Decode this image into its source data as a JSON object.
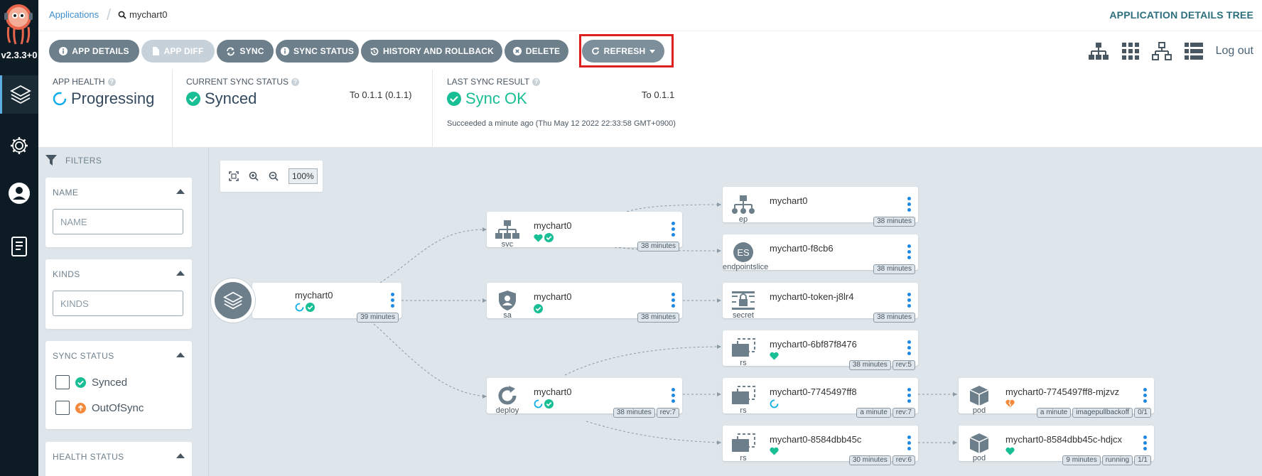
{
  "nav": {
    "version": "v2.3.3+0",
    "items": [
      {
        "icon": "layers-icon"
      },
      {
        "icon": "gear-icon"
      },
      {
        "icon": "user-icon"
      },
      {
        "icon": "docs-icon"
      }
    ]
  },
  "breadcrumb": {
    "root": "Applications",
    "current": "mychart0"
  },
  "page_title": "APPLICATION DETAILS TREE",
  "toolbar": {
    "app_details": "APP DETAILS",
    "app_diff": "APP DIFF",
    "sync": "SYNC",
    "sync_status": "SYNC STATUS",
    "history": "HISTORY AND ROLLBACK",
    "delete": "DELETE",
    "refresh": "REFRESH",
    "logout": "Log out"
  },
  "status": {
    "app_health_label": "APP HEALTH",
    "app_health_value": "Progressing",
    "sync_label": "CURRENT SYNC STATUS",
    "sync_value": "Synced",
    "sync_to": "To 0.1.1 (0.1.1)",
    "last_sync_label": "LAST SYNC RESULT",
    "last_sync_value": "Sync OK",
    "last_sync_to": "To 0.1.1",
    "last_sync_detail": "Succeeded a minute ago (Thu May 12 2022 22:33:58 GMT+0900)"
  },
  "filters": {
    "title": "FILTERS",
    "name_title": "NAME",
    "name_placeholder": "NAME",
    "kinds_title": "KINDS",
    "kinds_placeholder": "KINDS",
    "sync_status_title": "SYNC STATUS",
    "synced": "Synced",
    "outofsync": "OutOfSync",
    "health_status_title": "HEALTH STATUS"
  },
  "graph": {
    "zoom": "100%",
    "root": {
      "name": "mychart0",
      "tags": [
        "39 minutes"
      ]
    },
    "svc": {
      "kind": "svc",
      "name": "mychart0",
      "tags": [
        "38 minutes"
      ]
    },
    "sa": {
      "kind": "sa",
      "name": "mychart0",
      "tags": [
        "38 minutes"
      ]
    },
    "deploy": {
      "kind": "deploy",
      "name": "mychart0",
      "tags": [
        "38 minutes",
        "rev:7"
      ]
    },
    "ep": {
      "kind": "ep",
      "name": "mychart0",
      "tags": [
        "38 minutes"
      ]
    },
    "es": {
      "kind": "endpointslice",
      "name": "mychart0-f8cb6",
      "tags": [
        "38 minutes"
      ]
    },
    "secret": {
      "kind": "secret",
      "name": "mychart0-token-j8lr4",
      "tags": [
        "38 minutes"
      ]
    },
    "rs1": {
      "kind": "rs",
      "name": "mychart0-6bf87f8476",
      "tags": [
        "38 minutes",
        "rev:5"
      ]
    },
    "rs2": {
      "kind": "rs",
      "name": "mychart0-7745497ff8",
      "tags": [
        "a minute",
        "rev:7"
      ]
    },
    "rs3": {
      "kind": "rs",
      "name": "mychart0-8584dbb45c",
      "tags": [
        "30 minutes",
        "rev:6"
      ]
    },
    "pod1": {
      "kind": "pod",
      "name": "mychart0-7745497ff8-mjzvz",
      "tags": [
        "a minute",
        "imagepullbackoff",
        "0/1"
      ]
    },
    "pod2": {
      "kind": "pod",
      "name": "mychart0-8584dbb45c-hdjcx",
      "tags": [
        "9 minutes",
        "running",
        "1/1"
      ]
    }
  },
  "colors": {
    "synced": "#18be94",
    "progressing": "#0dadea",
    "degraded": "#e96d76",
    "outofsync": "#f4c030",
    "highlight": "#e01e1e"
  }
}
